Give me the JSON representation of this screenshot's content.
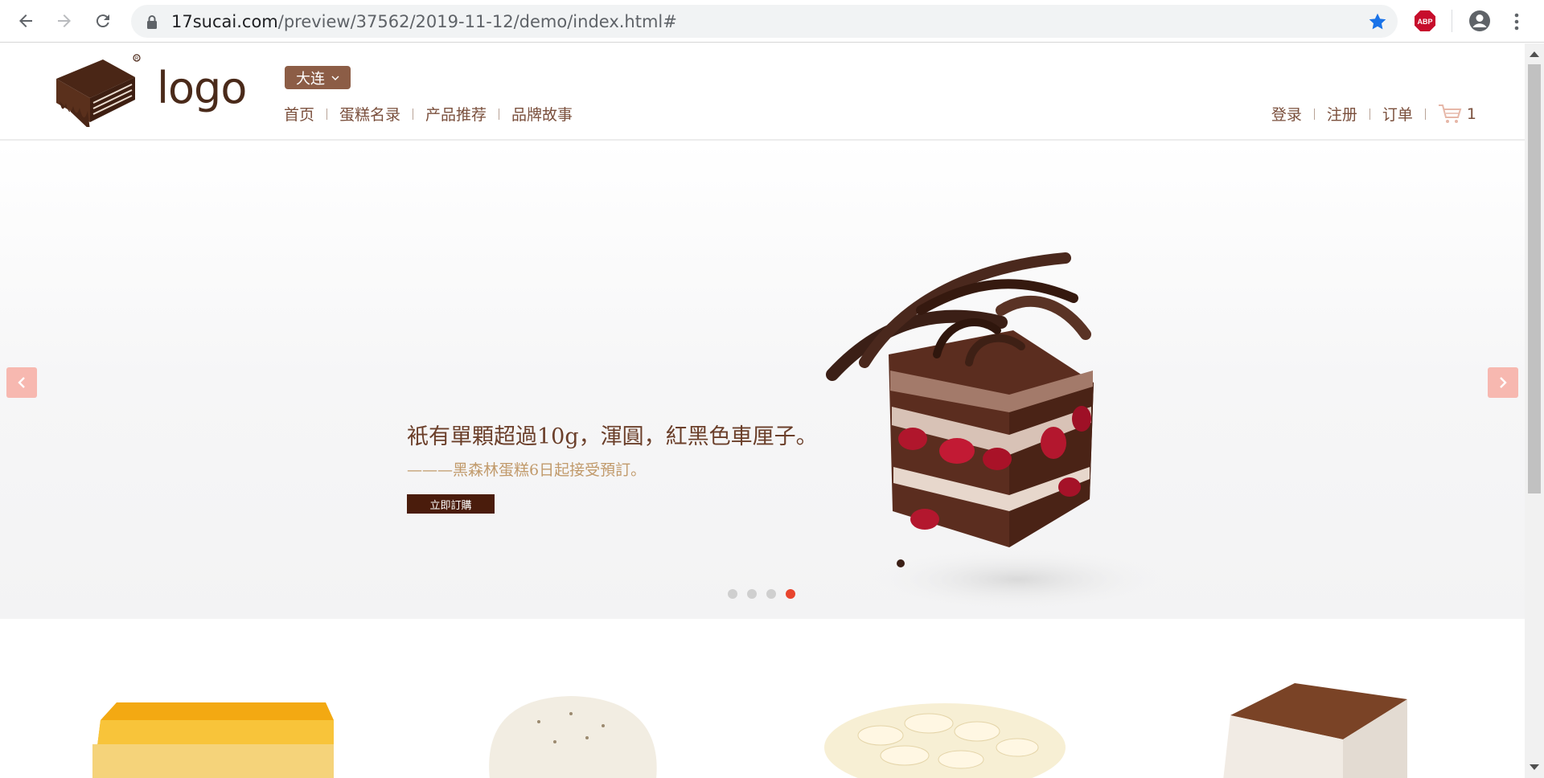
{
  "browser": {
    "url_host": "17sucai.com",
    "url_path": "/preview/37562/2019-11-12/demo/index.html#",
    "icons": [
      "back-icon",
      "forward-icon",
      "reload-icon",
      "lock-icon",
      "bookmark-star-icon",
      "adblock-icon",
      "profile-icon",
      "menu-icon"
    ]
  },
  "header": {
    "logo_text": "logo",
    "city": "大连",
    "nav": [
      "首页",
      "蛋糕名录",
      "产品推荐",
      "品牌故事"
    ],
    "user_nav": [
      "登录",
      "注册",
      "订单"
    ],
    "cart_count": "1"
  },
  "hero": {
    "title": "衹有單顆超過10g，渾圓，紅黑色車厘子。",
    "subtitle": "———黑森林蛋糕6日起接受預訂。",
    "button": "立即訂購",
    "slides": 4,
    "active_slide": 4
  },
  "colors": {
    "brand_brown": "#8c5d46",
    "nav_text": "#7a4f3c",
    "arrow_bg": "#f7b8b0",
    "active_dot": "#e8452e"
  }
}
